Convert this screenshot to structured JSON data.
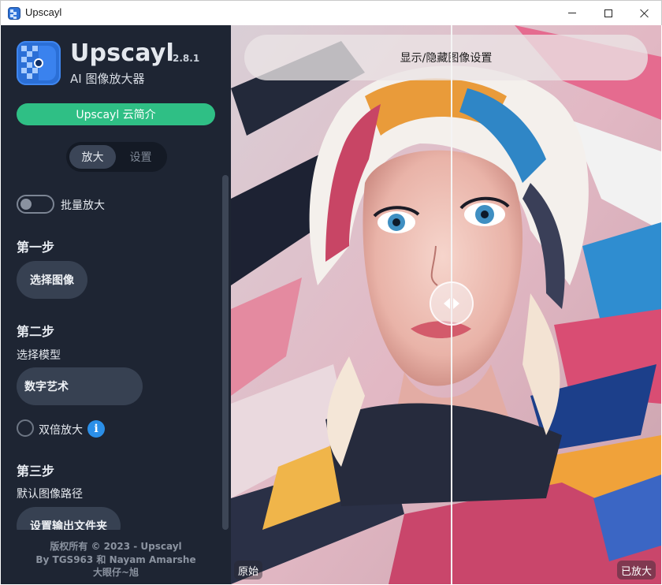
{
  "window": {
    "title": "Upscayl",
    "icon": "upscayl-app-icon",
    "controls": [
      "minimize-icon",
      "maximize-icon",
      "close-icon"
    ]
  },
  "sidebar": {
    "brand_name": "Upscayl",
    "version": "2.8.1",
    "subtitle": "AI 图像放大器",
    "cloud_button": "Upscayl 云简介",
    "tabs": [
      {
        "label": "放大",
        "active": true
      },
      {
        "label": "设置",
        "active": false
      }
    ],
    "batch_toggle": {
      "label": "批量放大",
      "on": false
    },
    "step1": {
      "title": "第一步",
      "button": "选择图像"
    },
    "step2": {
      "title": "第二步",
      "model_label": "选择模型",
      "model_value": "数字艺术",
      "double_label": "双倍放大",
      "double_checked": false,
      "info_icon": "i"
    },
    "step3": {
      "title": "第三步",
      "path_label": "默认图像路径",
      "button": "设置输出文件夹"
    },
    "footer": {
      "line1": "版权所有 © 2023 - Upscayl",
      "line2": "By TGS963 和 Nayam Amarshe",
      "line3": "大眼仔~旭"
    }
  },
  "viewer": {
    "settings_toggle": "显示/隐藏图像设置",
    "left_label": "原始",
    "right_label": "已放大",
    "slider_position": 0.51
  },
  "colors": {
    "sidebar_bg": "#1e2533",
    "accent_green": "#2fbf85",
    "info_blue": "#2b8fe8"
  }
}
